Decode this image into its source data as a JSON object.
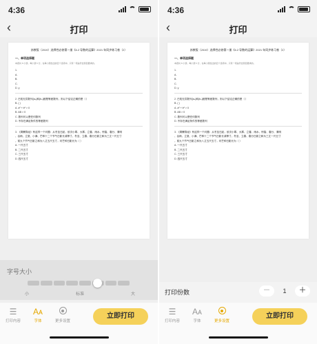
{
  "colors": {
    "accent": "#f5d15a",
    "active_tab": "#e5a800"
  },
  "document_lines": {
    "title": "苏教版（2019）选择性必修第一册《6.2 导数的运算》2021 年同步练习卷（2）",
    "section": "一、单项选择题",
    "note": "本题共 8 小题，每小题 5 分，在每小题给出的四个选项中，只有一项是符合题目要求的。",
    "q1": "1.",
    "q1_a": "A.",
    "q1_b": "B.",
    "q1_c": "C.",
    "q1_d": "D. y",
    "q2": "2. 已知无穷数列{aₙ}和{bₙ}都是等差数列，则以下结论正确的是（ ）",
    "q2_b": "B. ( )",
    "q2_c": "A. a² + b² > 0",
    "q2_d": "B. AB > 0",
    "q2_e": "C. 数列可以是任何数列",
    "q2_f": "D. 不存在满足条件的等差数列",
    "q3": "3. 《周髀算经》有这样一个问题：从冬至日起，依次小寒、大寒、立春、雨水、惊蛰、春分、清明",
    "q3_b": "、谷雨、立夏、小满、芒种十二个节气日影长减等寸，冬至、立春、春分日影之和为三丈一尺五寸",
    "q3_c": "，前九个节气日影之和为八丈五尺五寸，问芒种日影长为（ ）",
    "q3_a1": "A. 一尺五寸",
    "q3_a2": "B. 二尺五寸",
    "q3_a3": "C. 三尺五寸",
    "q3_a4": "D. 四尺五寸"
  },
  "left": {
    "status": {
      "time": "4:36"
    },
    "nav": {
      "title": "打印",
      "back_icon": "chevron-left-icon"
    },
    "font_size": {
      "label": "字号大小",
      "ticks": [
        "小",
        "标准",
        "大"
      ],
      "level": 0.68
    },
    "tabs": [
      {
        "label": "打印内容",
        "icon": "list-icon",
        "glyph": "☰",
        "active": false
      },
      {
        "label": "字体",
        "icon": "font-icon",
        "glyph": "Aᴀ",
        "active": true
      },
      {
        "label": "更多设置",
        "icon": "gear-icon",
        "glyph": "",
        "active": false
      }
    ],
    "print_button": "立即打印"
  },
  "right": {
    "status": {
      "time": "4:36"
    },
    "nav": {
      "title": "打印",
      "back_icon": "chevron-left-icon"
    },
    "copies": {
      "label": "打印份数",
      "minus": "－",
      "value": "1",
      "plus": "＋"
    },
    "tabs": [
      {
        "label": "打印内容",
        "icon": "list-icon",
        "glyph": "☰",
        "active": false
      },
      {
        "label": "字体",
        "icon": "font-icon",
        "glyph": "Aᴀ",
        "active": false
      },
      {
        "label": "更多设置",
        "icon": "gear-icon",
        "glyph": "",
        "active": true
      }
    ],
    "print_button": "立即打印"
  }
}
